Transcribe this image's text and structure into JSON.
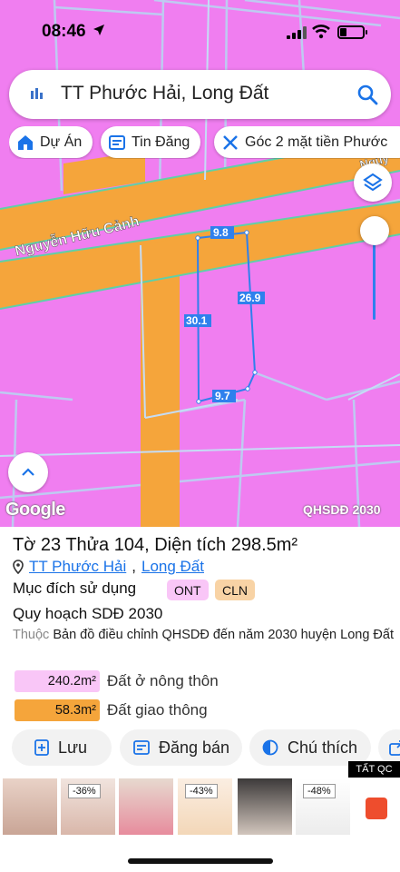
{
  "status": {
    "time": "08:46"
  },
  "search": {
    "query": "TT Phước Hải, Long Đất"
  },
  "chips": [
    {
      "label": "Dự Án",
      "icon": "home-icon"
    },
    {
      "label": "Tin Đăng",
      "icon": "news-icon"
    },
    {
      "label": "Góc 2 mặt tiền Phước",
      "icon": "tools-icon"
    }
  ],
  "map": {
    "road_name": "Nguyễn Hữu Cảnh",
    "road_name_partial": "Nguy",
    "dims": {
      "top": "9.8",
      "right": "26.9",
      "left": "30.1",
      "bottom": "9.7"
    },
    "google_logo": "Google",
    "overlay_label": "QHSDĐ 2030",
    "colors": {
      "residential": "#f07ef0",
      "traffic": "#f5a53b",
      "parcel_outline": "#2f80ed"
    }
  },
  "parcel": {
    "title": "Tờ 23 Thửa 104, Diện tích 298.5m²",
    "location_1": "TT Phước Hải",
    "location_2": "Long Đất",
    "purpose_label": "Mục đích sử dụng",
    "badges": [
      "ONT",
      "CLN"
    ],
    "plan_label": "Quy hoạch SDĐ 2030",
    "source_prefix": "Thuộc",
    "source_text": "Bản đồ điều chỉnh QHSDĐ đến năm 2030 huyện Long Đất",
    "areas": [
      {
        "value": "240.2m²",
        "label": "Đất ở nông thôn",
        "color": "#f9c6f7"
      },
      {
        "value": "58.3m²",
        "label": "Đất giao thông",
        "color": "#f5a53b"
      }
    ]
  },
  "actions": {
    "save": "Lưu",
    "post": "Đăng bán",
    "legend": "Chú thích"
  },
  "ads": {
    "close_label": "TẤT QC",
    "discounts": [
      "-36%",
      "-43%",
      "-48%"
    ]
  }
}
